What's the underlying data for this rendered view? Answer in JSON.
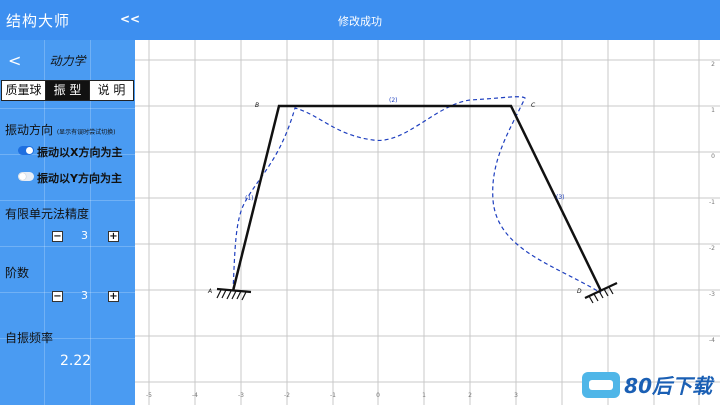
{
  "topbar": {
    "app_title": "结构大师",
    "collapse_label": "<<",
    "status": "修改成功"
  },
  "sidebar": {
    "back_label": "<",
    "panel_title": "动力学",
    "tabs": [
      {
        "label": "质量球"
      },
      {
        "label": "振 型"
      },
      {
        "label": "说 明"
      }
    ],
    "vibration": {
      "label": "振动方向",
      "hint": "(显示有误时尝试切换)",
      "option_x": "振动以X方向为主",
      "option_y": "振动以Y方向为主"
    },
    "precision": {
      "label": "有限单元法精度",
      "value": "3",
      "minus": "−",
      "plus": "+"
    },
    "order": {
      "label": "阶数",
      "value": "3",
      "minus": "−",
      "plus": "+"
    },
    "frequency": {
      "label": "自振频率",
      "value": "2.22"
    }
  },
  "canvas": {
    "x_ticks": [
      "-5",
      "-4",
      "-3",
      "-2",
      "-1",
      "0",
      "1",
      "2",
      "3"
    ],
    "y_ticks": [
      "2",
      "1",
      "0",
      "-1",
      "-2",
      "-3",
      "-4"
    ],
    "nodes": {
      "a": "A",
      "b": "B",
      "c": "C",
      "d": "D"
    },
    "members": {
      "m1": "(1)",
      "m2": "(2)",
      "m3": "(3)"
    },
    "colors": {
      "frame": "#111111",
      "mode": "#1e3fbf",
      "grid": "#c8c8c8"
    }
  },
  "watermark": {
    "text": "80后下载"
  }
}
